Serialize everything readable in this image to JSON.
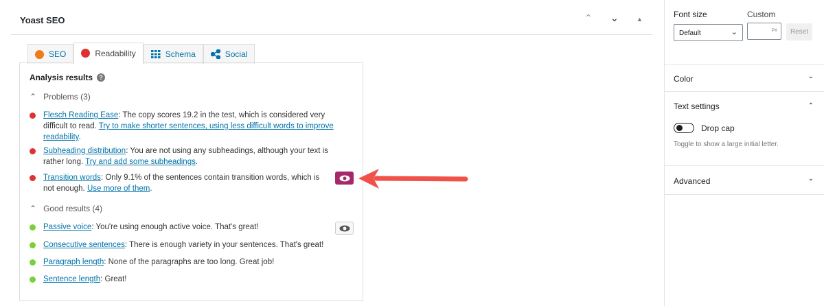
{
  "yoast": {
    "title": "Yoast SEO",
    "controls": [
      "⌃",
      "⌄",
      "▲"
    ],
    "tabs": [
      {
        "label": "SEO",
        "icon": "smiley-neutral-icon"
      },
      {
        "label": "Readability",
        "icon": "smiley-sad-icon"
      },
      {
        "label": "Schema",
        "icon": "grid-icon"
      },
      {
        "label": "Social",
        "icon": "share-icon"
      }
    ],
    "analysis_title": "Analysis results",
    "problems_label": "Problems (3)",
    "problems": [
      {
        "link": "Flesch Reading Ease",
        "text": ": The copy scores 19.2 in the test, which is considered very difficult to read. ",
        "action": "Try to make shorter sentences, using less difficult words to improve readability",
        "end": "."
      },
      {
        "link": "Subheading distribution",
        "text": ": You are not using any subheadings, although your text is rather long. ",
        "action": "Try and add some subheadings",
        "end": "."
      },
      {
        "link": "Transition words",
        "text": ": Only 9.1% of the sentences contain transition words, which is not enough. ",
        "action": "Use more of them",
        "end": "."
      }
    ],
    "good_label": "Good results (4)",
    "good": [
      {
        "link": "Passive voice",
        "text": ": You're using enough active voice. That's great!"
      },
      {
        "link": "Consecutive sentences",
        "text": ": There is enough variety in your sentences. That's great!"
      },
      {
        "link": "Paragraph length",
        "text": ": None of the paragraphs are too long. Great job!"
      },
      {
        "link": "Sentence length",
        "text": ": Great!"
      }
    ]
  },
  "sidebar": {
    "font_size_label": "Font size",
    "custom_label": "Custom",
    "font_size_value": "Default",
    "custom_unit": "PX",
    "reset": "Reset",
    "color": "Color",
    "text_settings": "Text settings",
    "drop_cap": "Drop cap",
    "drop_cap_help": "Toggle to show a large initial letter.",
    "advanced": "Advanced"
  },
  "colors": {
    "red": "#dc3232",
    "green": "#7ad03a",
    "orange": "#ee7c1b",
    "accent": "#a4286a",
    "arrow": "#f0524a",
    "link": "#0073aa"
  }
}
